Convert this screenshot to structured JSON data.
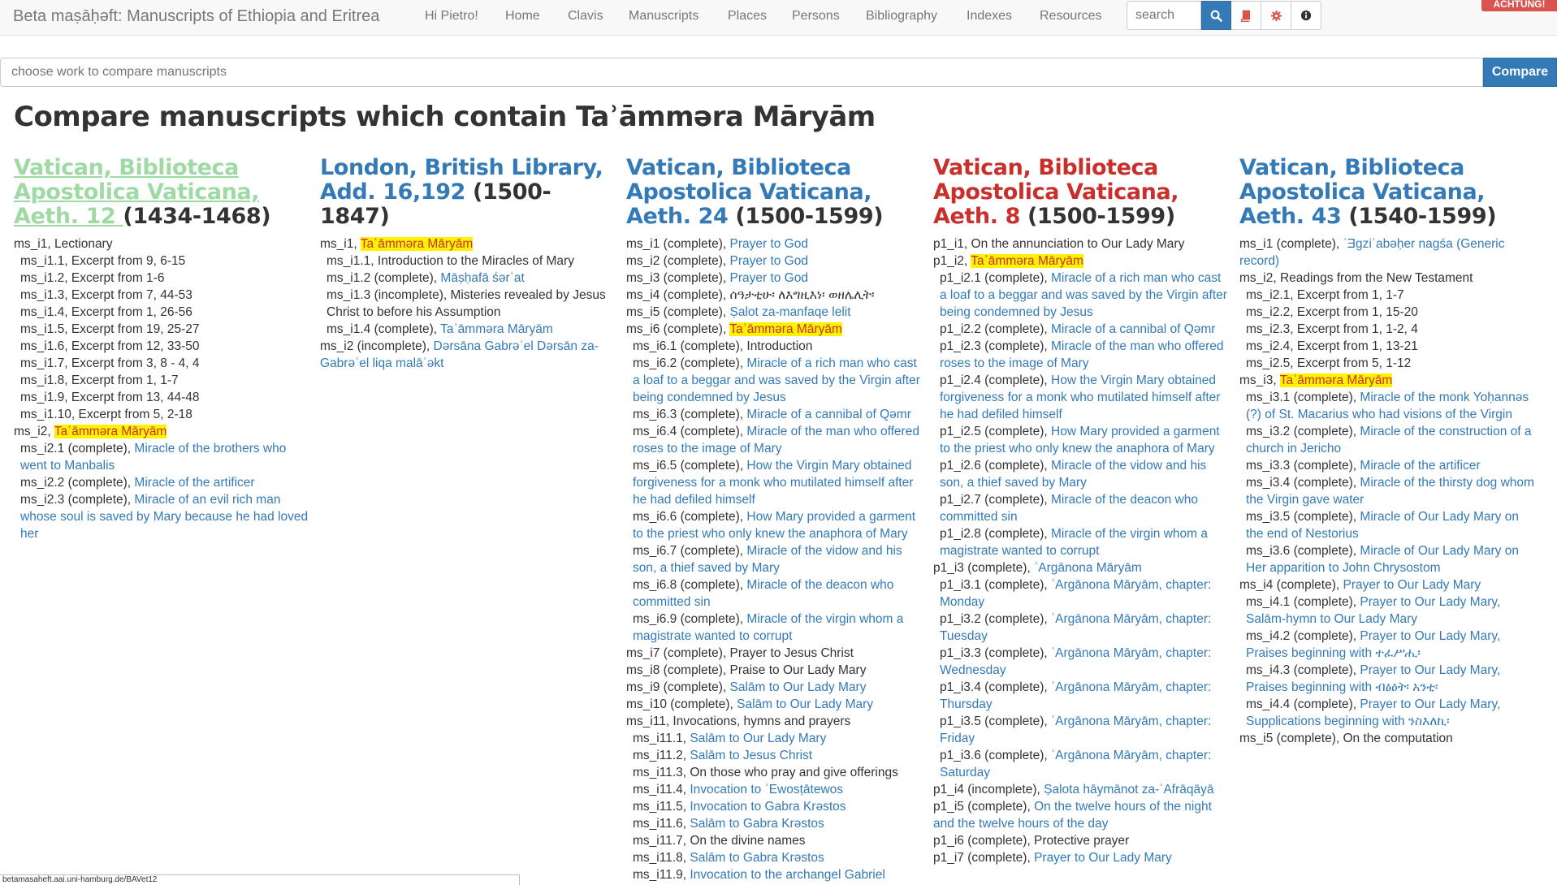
{
  "nav": {
    "brand": "Beta maṣāḥəft: Manuscripts of Ethiopia and Eritrea",
    "greeting": "Hi Pietro!",
    "links": [
      "Home",
      "Clavis",
      "Manuscripts",
      "Places",
      "Persons",
      "Bibliography",
      "Indexes",
      "Resources"
    ],
    "search_placeholder": "search",
    "achtung": "ACHTUNG!"
  },
  "compare": {
    "placeholder": "choose work to compare manuscripts",
    "button": "Compare"
  },
  "title": "Compare manuscripts which contain Taʾāmmərа Māryām",
  "columns": [
    {
      "title": "Vatican, Biblioteca Apostolica Vaticana, Aeth. 12",
      "date": "(1434-1468)",
      "title_color": "#9fd9a4",
      "items": [
        {
          "id": "ms_i1, Lectionary",
          "link": "",
          "hl": "",
          "sub": false
        },
        {
          "id": "ms_i1.1, Excerpt from 9, 6-15",
          "link": "",
          "hl": "",
          "sub": true
        },
        {
          "id": "ms_i1.2, Excerpt from 1-6",
          "link": "",
          "hl": "",
          "sub": true
        },
        {
          "id": "ms_i1.3, Excerpt from 7, 44-53",
          "link": "",
          "hl": "",
          "sub": true
        },
        {
          "id": "ms_i1.4, Excerpt from 1, 26-56",
          "link": "",
          "hl": "",
          "sub": true
        },
        {
          "id": "ms_i1.5, Excerpt from 19, 25-27",
          "link": "",
          "hl": "",
          "sub": true
        },
        {
          "id": "ms_i1.6, Excerpt from 12, 33-50",
          "link": "",
          "hl": "",
          "sub": true
        },
        {
          "id": "ms_i1.7, Excerpt from 3, 8 - 4, 4",
          "link": "",
          "hl": "",
          "sub": true
        },
        {
          "id": "ms_i1.8, Excerpt from 1, 1-7",
          "link": "",
          "hl": "",
          "sub": true
        },
        {
          "id": "ms_i1.9, Excerpt from 13, 44-48",
          "link": "",
          "hl": "",
          "sub": true
        },
        {
          "id": "ms_i1.10, Excerpt from 5, 2-18",
          "link": "",
          "hl": "",
          "sub": true
        },
        {
          "id": "ms_i2, ",
          "link": "",
          "hl": "Taʾāmmərа Māryām",
          "sub": false
        },
        {
          "id": "ms_i2.1 (complete), ",
          "link": "Miracle of the brothers who went to Manbalis",
          "hl": "",
          "sub": true
        },
        {
          "id": "ms_i2.2 (complete), ",
          "link": "Miracle of the artificer",
          "hl": "",
          "sub": true
        },
        {
          "id": "ms_i2.3 (complete), ",
          "link": "Miracle of an evil rich man whose soul is saved by Mary because he had loved her",
          "hl": "",
          "sub": true
        }
      ]
    },
    {
      "title": "London, British Library, Add. 16,192",
      "date": "(1500-1847)",
      "title_color": "#337ab7",
      "items": [
        {
          "id": "ms_i1, ",
          "link": "",
          "hl": "Taʾāmmərа Māryām",
          "sub": false
        },
        {
          "id": "ms_i1.1, Introduction to the Miracles of Mary",
          "link": "",
          "hl": "",
          "sub": true
        },
        {
          "id": "ms_i1.2 (complete), ",
          "link": "Māṣḥafā śərʿat",
          "hl": "",
          "sub": true
        },
        {
          "id": "ms_i1.3 (incomplete), Misteries revealed by Jesus Christ to before his Assumption",
          "link": "",
          "hl": "",
          "sub": true
        },
        {
          "id": "ms_i1.4 (complete), ",
          "link": "Taʾāmmərа Māryām",
          "hl": "",
          "sub": true
        },
        {
          "id": "ms_i2 (incomplete), ",
          "link": "Dərsāna Gabrəʾel Dərsān za-Gabrəʾel liqa malāʾəkt",
          "hl": "",
          "sub": false
        }
      ]
    },
    {
      "title": "Vatican, Biblioteca Apostolica Vaticana, Aeth. 24",
      "date": "(1500-1599)",
      "title_color": "#337ab7",
      "items": [
        {
          "id": "ms_i1 (complete), ",
          "link": "Prayer to God",
          "hl": "",
          "sub": false
        },
        {
          "id": "ms_i2 (complete), ",
          "link": "Prayer to God",
          "hl": "",
          "sub": false
        },
        {
          "id": "ms_i3 (complete), ",
          "link": "Prayer to God",
          "hl": "",
          "sub": false
        },
        {
          "id": "ms_i4 (complete), ሰዓታቲሁ፡ ለእግዚእነ፡ ወዘሌሊት፡",
          "link": "",
          "hl": "",
          "sub": false
        },
        {
          "id": "ms_i5 (complete), ",
          "link": "Ṣalot za-manfaqe lelit",
          "hl": "",
          "sub": false
        },
        {
          "id": "ms_i6 (complete), ",
          "link": "",
          "hl": "Taʾāmmərа Māryām",
          "sub": false
        },
        {
          "id": "ms_i6.1 (complete), Introduction",
          "link": "",
          "hl": "",
          "sub": true
        },
        {
          "id": "ms_i6.2 (complete), ",
          "link": "Miracle of a rich man who cast a loaf to a beggar and was saved by the Virgin after being condemned by Jesus",
          "hl": "",
          "sub": true
        },
        {
          "id": "ms_i6.3 (complete), ",
          "link": "Miracle of a cannibal of Qəmr",
          "hl": "",
          "sub": true
        },
        {
          "id": "ms_i6.4 (complete), ",
          "link": "Miracle of the man who offered roses to the image of Mary",
          "hl": "",
          "sub": true
        },
        {
          "id": "ms_i6.5 (complete), ",
          "link": "How the Virgin Mary obtained forgiveness for a monk who mutilated himself after he had defiled himself",
          "hl": "",
          "sub": true
        },
        {
          "id": "ms_i6.6 (complete), ",
          "link": "How Mary provided a garment to the priest who only knew the anaphora of Mary",
          "hl": "",
          "sub": true
        },
        {
          "id": "ms_i6.7 (complete), ",
          "link": "Miracle of the vidow and his son, a thief saved by Mary",
          "hl": "",
          "sub": true
        },
        {
          "id": "ms_i6.8 (complete), ",
          "link": "Miracle of the deacon who committed sin",
          "hl": "",
          "sub": true
        },
        {
          "id": "ms_i6.9 (complete), ",
          "link": "Miracle of the virgin whom a magistrate wanted to corrupt",
          "hl": "",
          "sub": true
        },
        {
          "id": "ms_i7 (complete), Prayer to Jesus Christ",
          "link": "",
          "hl": "",
          "sub": false
        },
        {
          "id": "ms_i8 (complete), Praise to Our Lady Mary",
          "link": "",
          "hl": "",
          "sub": false
        },
        {
          "id": "ms_i9 (complete), ",
          "link": "Salām to Our Lady Mary",
          "hl": "",
          "sub": false
        },
        {
          "id": "ms_i10 (complete), ",
          "link": "Salām to Our Lady Mary",
          "hl": "",
          "sub": false
        },
        {
          "id": "ms_i11, Invocations, hymns and prayers",
          "link": "",
          "hl": "",
          "sub": false
        },
        {
          "id": "ms_i11.1, ",
          "link": "Salām to Our Lady Mary",
          "hl": "",
          "sub": true
        },
        {
          "id": "ms_i11.2, ",
          "link": "Salām to Jesus Christ",
          "hl": "",
          "sub": true
        },
        {
          "id": "ms_i11.3, On those who pray and give offerings",
          "link": "",
          "hl": "",
          "sub": true
        },
        {
          "id": "ms_i11.4, ",
          "link": "Invocation to ʾEwosṭātewos",
          "hl": "",
          "sub": true
        },
        {
          "id": "ms_i11.5, ",
          "link": "Invocation to Gabra Krəstos",
          "hl": "",
          "sub": true
        },
        {
          "id": "ms_i11.6, ",
          "link": "Salām to Gabra Krəstos",
          "hl": "",
          "sub": true
        },
        {
          "id": "ms_i11.7, On the divine names",
          "link": "",
          "hl": "",
          "sub": true
        },
        {
          "id": "ms_i11.8, ",
          "link": "Salām to Gabra Krəstos",
          "hl": "",
          "sub": true
        },
        {
          "id": "ms_i11.9, ",
          "link": "Invocation to the archangel Gabriel",
          "hl": "",
          "sub": true
        }
      ]
    },
    {
      "title": "Vatican, Biblioteca Apostolica Vaticana, Aeth. 8",
      "date": "(1500-1599)",
      "title_color": "#c9302c",
      "items": [
        {
          "id": "p1_i1, On the annunciation to Our Lady Mary",
          "link": "",
          "hl": "",
          "sub": false
        },
        {
          "id": "p1_i2, ",
          "link": "",
          "hl": "Taʾāmmərа Māryām",
          "sub": false
        },
        {
          "id": "p1_i2.1 (complete), ",
          "link": "Miracle of a rich man who cast a loaf to a beggar and was saved by the Virgin after being condemned by Jesus",
          "hl": "",
          "sub": true
        },
        {
          "id": "p1_i2.2 (complete), ",
          "link": "Miracle of a cannibal of Qəmr",
          "hl": "",
          "sub": true
        },
        {
          "id": "p1_i2.3 (complete), ",
          "link": "Miracle of the man who offered roses to the image of Mary",
          "hl": "",
          "sub": true
        },
        {
          "id": "p1_i2.4 (complete), ",
          "link": "How the Virgin Mary obtained forgiveness for a monk who mutilated himself after he had defiled himself",
          "hl": "",
          "sub": true
        },
        {
          "id": "p1_i2.5 (complete), ",
          "link": "How Mary provided a garment to the priest who only knew the anaphora of Mary",
          "hl": "",
          "sub": true
        },
        {
          "id": "p1_i2.6 (complete), ",
          "link": "Miracle of the vidow and his son, a thief saved by Mary",
          "hl": "",
          "sub": true
        },
        {
          "id": "p1_i2.7 (complete), ",
          "link": "Miracle of the deacon who committed sin",
          "hl": "",
          "sub": true
        },
        {
          "id": "p1_i2.8 (complete), ",
          "link": "Miracle of the virgin whom a magistrate wanted to corrupt",
          "hl": "",
          "sub": true
        },
        {
          "id": "p1_i3 (complete), ",
          "link": "ʾArgānona Māryām",
          "hl": "",
          "sub": false
        },
        {
          "id": "p1_i3.1 (complete), ",
          "link": "ʾArgānona Māryām, chapter: Monday",
          "hl": "",
          "sub": true
        },
        {
          "id": "p1_i3.2 (complete), ",
          "link": "ʾArgānona Māryām, chapter: Tuesday",
          "hl": "",
          "sub": true
        },
        {
          "id": "p1_i3.3 (complete), ",
          "link": "ʾArgānona Māryām, chapter: Wednesday",
          "hl": "",
          "sub": true
        },
        {
          "id": "p1_i3.4 (complete), ",
          "link": "ʾArgānona Māryām, chapter: Thursday",
          "hl": "",
          "sub": true
        },
        {
          "id": "p1_i3.5 (complete), ",
          "link": "ʾArgānona Māryām, chapter: Friday",
          "hl": "",
          "sub": true
        },
        {
          "id": "p1_i3.6 (complete), ",
          "link": "ʾArgānona Māryām, chapter: Saturday",
          "hl": "",
          "sub": true
        },
        {
          "id": "p1_i4 (incomplete), ",
          "link": "Ṣalota hāymānot za-ʾAfrāqāyā",
          "hl": "",
          "sub": false
        },
        {
          "id": "p1_i5 (complete), ",
          "link": "On the twelve hours of the night and the twelve hours of the day",
          "hl": "",
          "sub": false
        },
        {
          "id": "p1_i6 (complete), Protective prayer",
          "link": "",
          "hl": "",
          "sub": false
        },
        {
          "id": "p1_i7 (complete), ",
          "link": "Prayer to Our Lady Mary",
          "hl": "",
          "sub": false
        }
      ]
    },
    {
      "title": "Vatican, Biblioteca Apostolica Vaticana, Aeth. 43",
      "date": "(1540-1599)",
      "title_color": "#337ab7",
      "items": [
        {
          "id": "ms_i1 (complete), ",
          "link": "ʾƎgziʾabəḥer nagśa (Generic record)",
          "hl": "",
          "sub": false
        },
        {
          "id": "ms_i2, Readings from the New Testament",
          "link": "",
          "hl": "",
          "sub": false
        },
        {
          "id": "ms_i2.1, Excerpt from 1, 1-7",
          "link": "",
          "hl": "",
          "sub": true
        },
        {
          "id": "ms_i2.2, Excerpt from 1, 15-20",
          "link": "",
          "hl": "",
          "sub": true
        },
        {
          "id": "ms_i2.3, Excerpt from 1, 1-2, 4",
          "link": "",
          "hl": "",
          "sub": true
        },
        {
          "id": "ms_i2.4, Excerpt from 1, 13-21",
          "link": "",
          "hl": "",
          "sub": true
        },
        {
          "id": "ms_i2.5, Excerpt from 5, 1-12",
          "link": "",
          "hl": "",
          "sub": true
        },
        {
          "id": "ms_i3, ",
          "link": "",
          "hl": "Taʾāmmərа Māryām",
          "sub": false
        },
        {
          "id": "ms_i3.1 (complete), ",
          "link": "Miracle of the monk Yoḥannəs (?) of St. Macarius who had visions of the Virgin",
          "hl": "",
          "sub": true
        },
        {
          "id": "ms_i3.2 (complete), ",
          "link": "Miracle of the construction of a church in Jericho",
          "hl": "",
          "sub": true
        },
        {
          "id": "ms_i3.3 (complete), ",
          "link": "Miracle of the artificer",
          "hl": "",
          "sub": true
        },
        {
          "id": "ms_i3.4 (complete), ",
          "link": "Miracle of the thirsty dog whom the Virgin gave water",
          "hl": "",
          "sub": true
        },
        {
          "id": "ms_i3.5 (complete), ",
          "link": "Miracle of Our Lady Mary on the end of Nestorius",
          "hl": "",
          "sub": true
        },
        {
          "id": "ms_i3.6 (complete), ",
          "link": "Miracle of Our Lady Mary on Her apparition to John Chrysostom",
          "hl": "",
          "sub": true
        },
        {
          "id": "ms_i4 (complete), ",
          "link": "Prayer to Our Lady Mary",
          "hl": "",
          "sub": false
        },
        {
          "id": "ms_i4.1 (complete), ",
          "link": "Prayer to Our Lady Mary, Salām-hymn to Our Lady Mary",
          "hl": "",
          "sub": true
        },
        {
          "id": "ms_i4.2 (complete), ",
          "link": "Prayer to Our Lady Mary, Praises beginning with ተፈሥሒ፡",
          "hl": "",
          "sub": true
        },
        {
          "id": "ms_i4.3 (complete), ",
          "link": "Prayer to Our Lady Mary, Praises beginning with ብፅዕት፡ አንቲ፡",
          "hl": "",
          "sub": true
        },
        {
          "id": "ms_i4.4 (complete), ",
          "link": "Prayer to Our Lady Mary, Supplications beginning with ንስእለኪ፡",
          "hl": "",
          "sub": true
        },
        {
          "id": "ms_i5 (complete), On the computation",
          "link": "",
          "hl": "",
          "sub": false
        }
      ]
    }
  ],
  "status_url": "betamasaheft.aai.uni-hamburg.de/BAVet12"
}
